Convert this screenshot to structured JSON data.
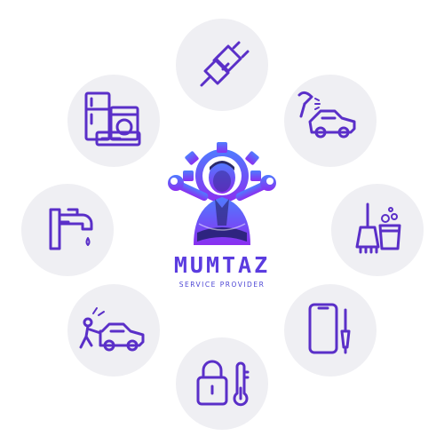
{
  "brand": {
    "name": "MUMTAZ",
    "tagline": "SERVICE PROVIDER",
    "colors": {
      "primary": "#5b3ce0",
      "gradient_start": "#6b5cff",
      "gradient_end": "#8a36f0",
      "bubble": "#efeff3"
    }
  },
  "services": [
    {
      "icon": "electric-plug-icon"
    },
    {
      "icon": "car-wash-icon"
    },
    {
      "icon": "cleaning-supplies-icon"
    },
    {
      "icon": "phone-repair-icon"
    },
    {
      "icon": "lock-thermometer-icon"
    },
    {
      "icon": "car-repair-icon"
    },
    {
      "icon": "water-tap-icon"
    },
    {
      "icon": "home-appliances-icon"
    }
  ]
}
